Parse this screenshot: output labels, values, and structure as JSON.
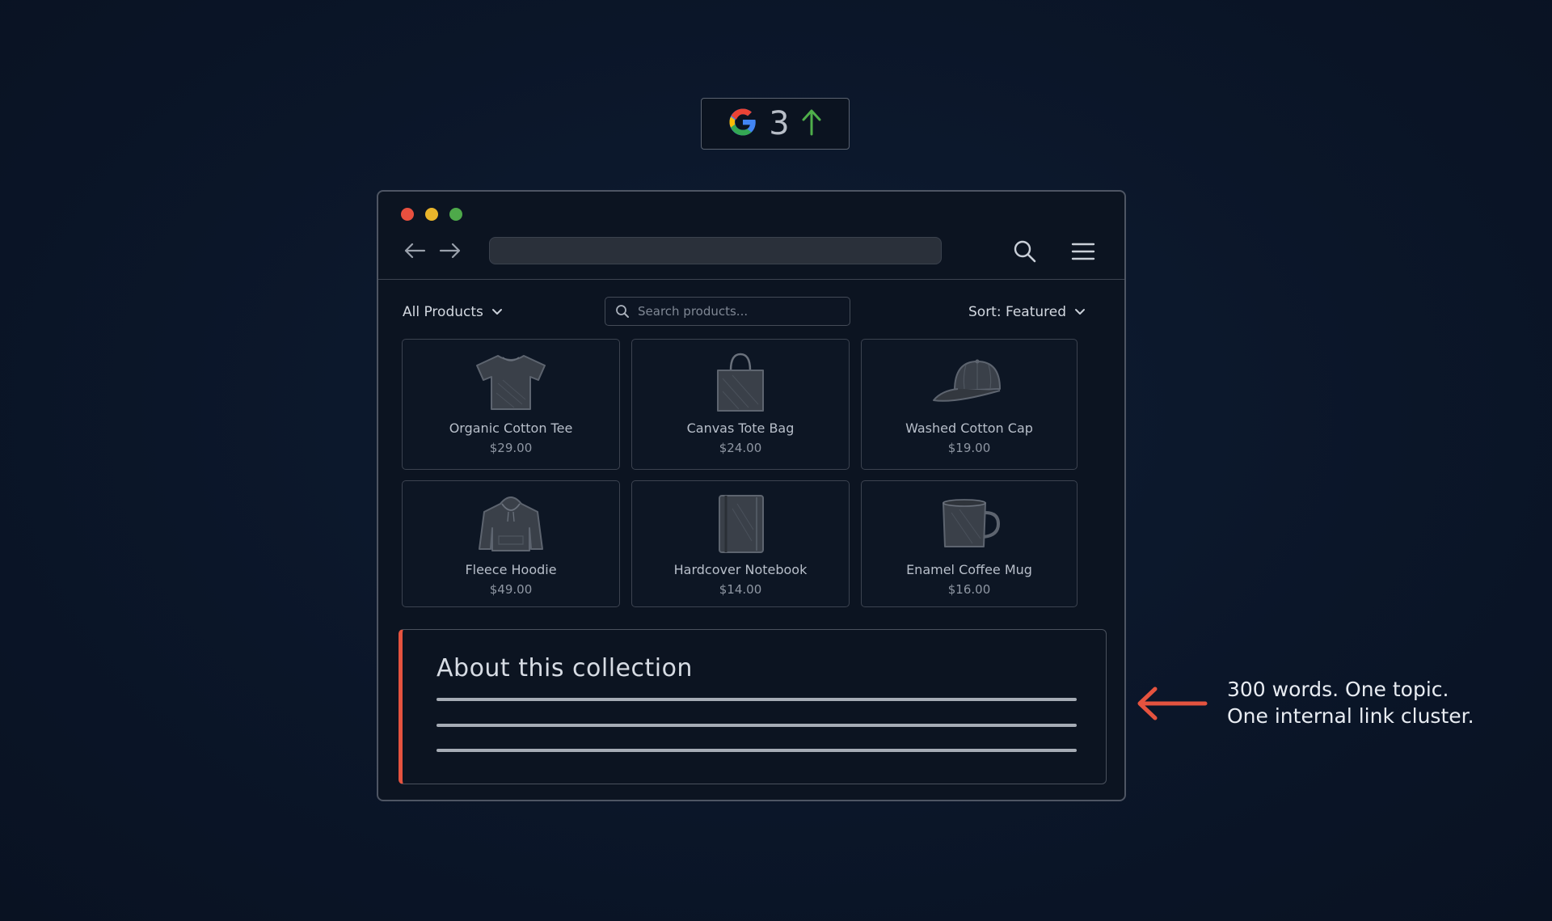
{
  "rank_badge": {
    "icon": "google-g-icon",
    "rank": "3",
    "trend_icon": "arrow-up-icon",
    "colors": {
      "blue": "#4285F4",
      "red": "#EA4335",
      "yellow": "#FBBC05",
      "green": "#34A853"
    }
  },
  "browser": {
    "window_controls": [
      "close",
      "minimize",
      "maximize"
    ],
    "nav": {
      "back_icon": "arrow-left-icon",
      "forward_icon": "arrow-right-icon"
    },
    "address_bar": {
      "value": ""
    },
    "toolbar": {
      "search_icon": "search-icon",
      "menu_icon": "hamburger-menu-icon"
    }
  },
  "filters": {
    "category": "All Products",
    "search_placeholder": "Search products...",
    "sort": "Sort: Featured"
  },
  "products": [
    {
      "name": "Organic Cotton Tee",
      "price": "$29.00",
      "icon": "t-shirt-icon"
    },
    {
      "name": "Canvas Tote Bag",
      "price": "$24.00",
      "icon": "tote-bag-icon"
    },
    {
      "name": "Washed Cotton Cap",
      "price": "$19.00",
      "icon": "cap-icon"
    },
    {
      "name": "Fleece Hoodie",
      "price": "$49.00",
      "icon": "hoodie-icon"
    },
    {
      "name": "Hardcover Notebook",
      "price": "$14.00",
      "icon": "notebook-icon"
    },
    {
      "name": "Enamel Coffee Mug",
      "price": "$16.00",
      "icon": "mug-icon"
    }
  ],
  "about": {
    "title": "About this collection",
    "accent_color": "#E5533F"
  },
  "callout": {
    "line1": "300 words. One topic.",
    "line2": "One internal link cluster.",
    "arrow_color": "#E5533F"
  }
}
